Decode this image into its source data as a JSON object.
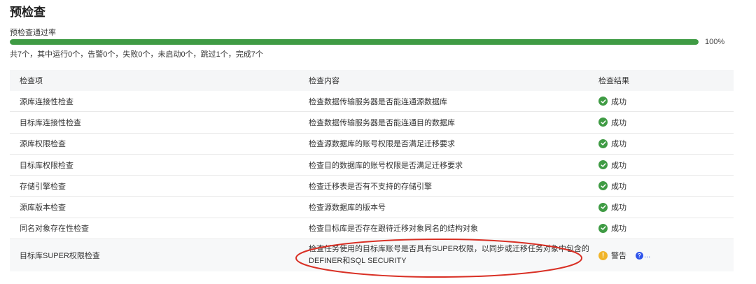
{
  "page": {
    "title": "预检查"
  },
  "pass_rate": {
    "label": "预检查通过率",
    "percent_text": "100%",
    "fraction": 1.0
  },
  "summary": "共7个，其中运行0个，告警0个，失败0个，未启动0个，跳过1个，完成7个",
  "table": {
    "columns": [
      "检查项",
      "检查内容",
      "检查结果"
    ],
    "rows": [
      {
        "item": "源库连接性检查",
        "content": "检查数据传输服务器是否能连通源数据库",
        "result": "成功",
        "status": "success"
      },
      {
        "item": "目标库连接性检查",
        "content": "检查数据传输服务器是否能连通目的数据库",
        "result": "成功",
        "status": "success"
      },
      {
        "item": "源库权限检查",
        "content": "检查源数据库的账号权限是否满足迁移要求",
        "result": "成功",
        "status": "success"
      },
      {
        "item": "目标库权限检查",
        "content": "检查目的数据库的账号权限是否满足迁移要求",
        "result": "成功",
        "status": "success"
      },
      {
        "item": "存储引擎检查",
        "content": "检查迁移表是否有不支持的存储引擎",
        "result": "成功",
        "status": "success"
      },
      {
        "item": "源库版本检查",
        "content": "检查源数据库的版本号",
        "result": "成功",
        "status": "success"
      },
      {
        "item": "同名对象存在性检查",
        "content": "检查目标库是否存在跟待迁移对象同名的结构对象",
        "result": "成功",
        "status": "success"
      }
    ],
    "last_row": {
      "item": "目标库SUPER权限检查",
      "content_line1": "检查任务使用的目标库账号是否具有SUPER权限，以同步或迁移任务对象中包含的",
      "content_line2": "DEFINER和SQL SECURITY",
      "result": "警告",
      "status": "warning",
      "help_glyph": "?",
      "more_text": "..."
    }
  },
  "colors": {
    "success": "#3f9b44",
    "warning": "#f0b429",
    "link": "#2f54eb",
    "annotation": "#d93025"
  },
  "icons": {
    "success": "check-circle-icon",
    "warning": "warning-circle-icon",
    "help": "question-circle-icon"
  }
}
